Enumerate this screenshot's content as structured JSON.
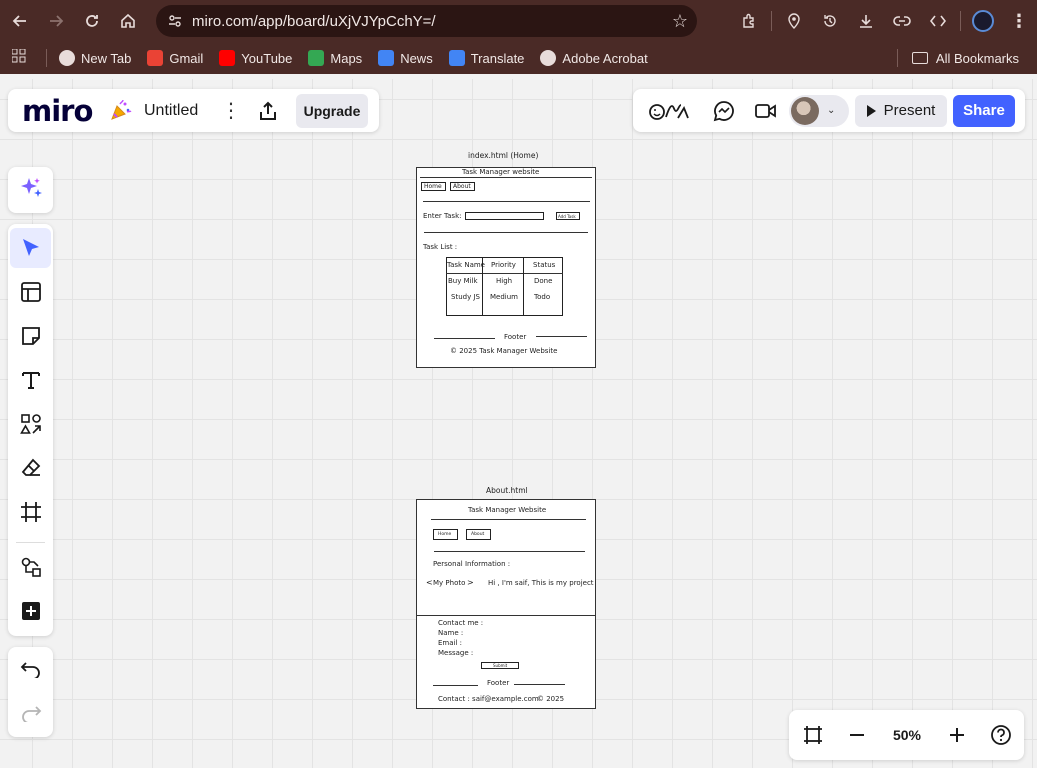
{
  "browser": {
    "url": "miro.com/app/board/uXjVJYpCchY=/",
    "bookmarks": [
      {
        "label": "New Tab",
        "icon": "globe-icon",
        "color": "#e8dcda"
      },
      {
        "label": "Gmail",
        "icon": "gmail-icon",
        "color": "#ea4335"
      },
      {
        "label": "YouTube",
        "icon": "youtube-icon",
        "color": "#ff0000"
      },
      {
        "label": "Maps",
        "icon": "maps-icon",
        "color": "#34a853"
      },
      {
        "label": "News",
        "icon": "news-icon",
        "color": "#4285f4"
      },
      {
        "label": "Translate",
        "icon": "translate-icon",
        "color": "#4285f4"
      },
      {
        "label": "Adobe Acrobat",
        "icon": "globe-icon",
        "color": "#e8dcda"
      }
    ],
    "all_bookmarks": "All Bookmarks"
  },
  "miro": {
    "logo": "miro",
    "board_title": "Untitled",
    "upgrade": "Upgrade",
    "present": "Present",
    "share": "Share",
    "zoom": "50%",
    "accent": "#4262ff"
  },
  "wireframe_home": {
    "caption": "index.html (Home)",
    "header": "Task Manager website",
    "nav": [
      "Home",
      "About"
    ],
    "enter_task": "Enter Task:",
    "add_task": "Add Task",
    "task_list": "Task List :",
    "table_headers": [
      "Task Name",
      "Priority",
      "Status"
    ],
    "table_rows": [
      [
        "Buy Milk",
        "High",
        "Done"
      ],
      [
        "Study JS",
        "Medium",
        "Todo"
      ]
    ],
    "footer": "Footer",
    "copyright": "© 2025 Task Manager Website"
  },
  "wireframe_about": {
    "caption": "About.html",
    "header": "Task Manager Website",
    "nav": [
      "Home",
      "About"
    ],
    "personal_info": "Personal Information :",
    "photo": "My Photo",
    "intro": "Hi , I'm saif, This is my project",
    "contact_me": "Contact me :",
    "name": "Name :",
    "email": "Email :",
    "message": "Message :",
    "submit": "Submit",
    "footer": "Footer",
    "contact_line": "Contact : saif@example.com",
    "year": "© 2025"
  }
}
